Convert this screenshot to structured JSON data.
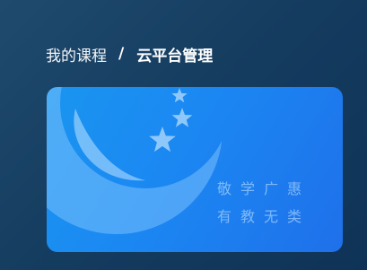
{
  "breadcrumb": {
    "parent": "我的课程",
    "separator": "/",
    "current": "云平台管理"
  },
  "course_card": {
    "motto_line_1": "敬学广惠",
    "motto_line_2": "有教无类",
    "logo_icon": "moon-stars-logo-icon"
  },
  "colors": {
    "page_background": "#153d60",
    "card_gradient_start": "#1a95f0",
    "card_gradient_end": "#1f70ea",
    "text": "#ffffff"
  }
}
